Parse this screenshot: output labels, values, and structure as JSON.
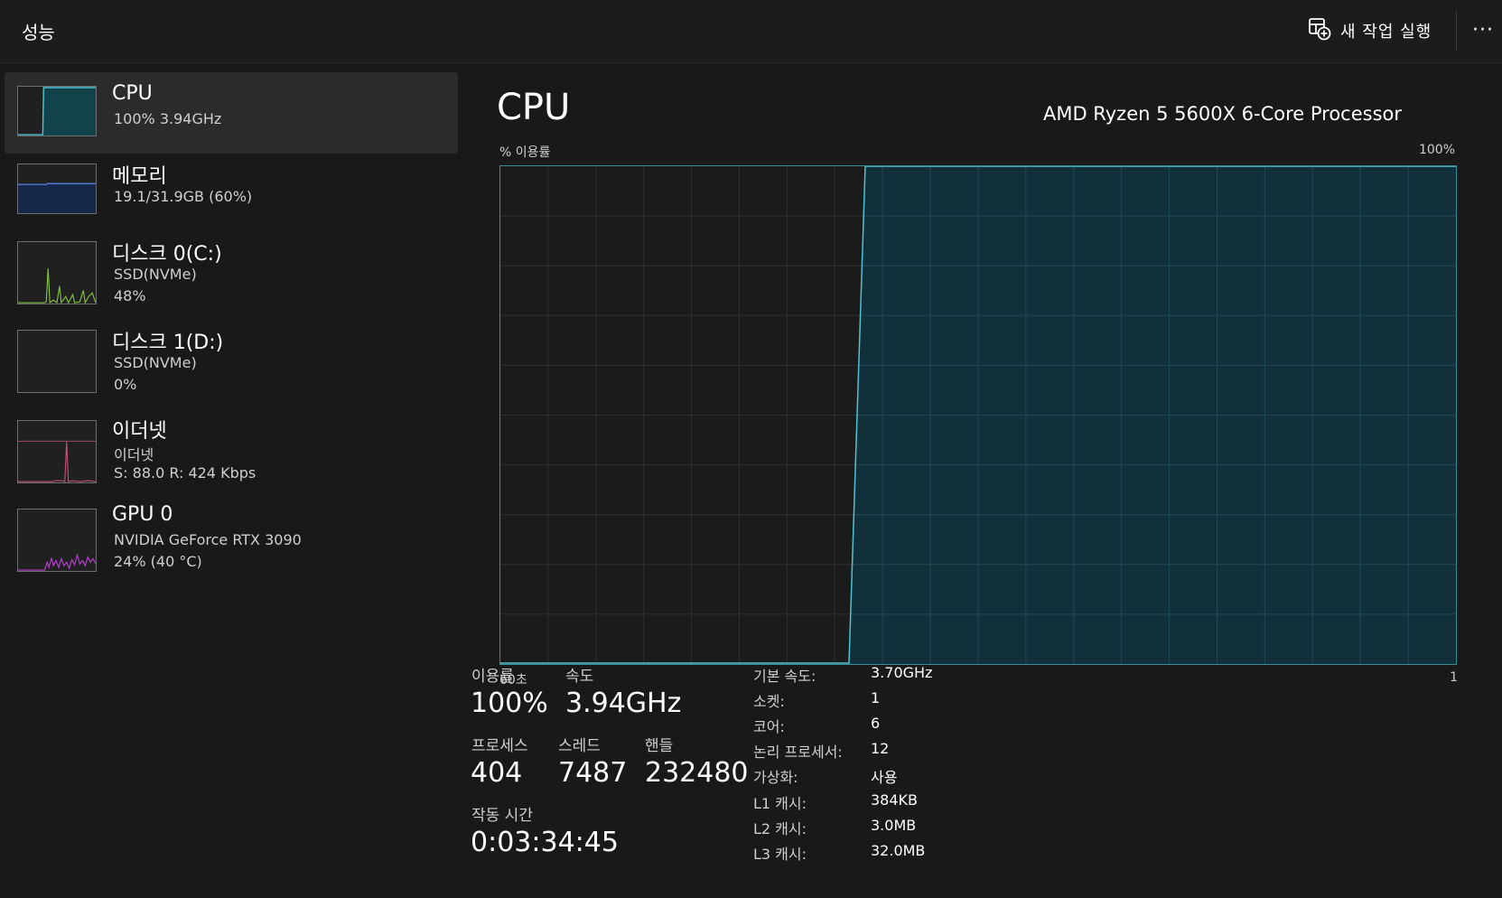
{
  "header": {
    "title": "성능",
    "new_task_label": "새 작업 실행",
    "more_label": "···"
  },
  "sidebar": {
    "items": [
      {
        "title": "CPU",
        "sub1": "100%  3.94GHz",
        "sub2": "",
        "color": "#4fc1d2",
        "active": true
      },
      {
        "title": "메모리",
        "sub1": "19.1/31.9GB (60%)",
        "sub2": "",
        "color": "#4f7bd2"
      },
      {
        "title": "디스크 0(C:)",
        "sub1": "SSD(NVMe)",
        "sub2": "48%",
        "color": "#7fbf3f"
      },
      {
        "title": "디스크 1(D:)",
        "sub1": "SSD(NVMe)",
        "sub2": "0%",
        "color": "#7fbf3f"
      },
      {
        "title": "이더넷",
        "sub1": "이더넷",
        "sub2": "S: 88.0  R: 424 Kbps",
        "color": "#c0527a"
      },
      {
        "title": "GPU 0",
        "sub1": "NVIDIA GeForce RTX 3090",
        "sub2": "24% (40 °C)",
        "color": "#b63fcf"
      }
    ]
  },
  "main": {
    "title": "CPU",
    "model": "AMD Ryzen 5 5600X 6-Core Processor",
    "graph_label_left": "% 이용률",
    "graph_label_right": "100%",
    "axis_left": "60초",
    "axis_right": "1",
    "stats": {
      "utilization_label": "이용률",
      "utilization_value": "100%",
      "speed_label": "속도",
      "speed_value": "3.94GHz",
      "process_label": "프로세스",
      "process_value": "404",
      "thread_label": "스레드",
      "thread_value": "7487",
      "handle_label": "핸들",
      "handle_value": "232480",
      "uptime_label": "작동 시간",
      "uptime_value": "0:03:34:45"
    },
    "info": [
      {
        "key": "기본 속도:",
        "value": "3.70GHz"
      },
      {
        "key": "소켓:",
        "value": "1"
      },
      {
        "key": "코어:",
        "value": "6"
      },
      {
        "key": "논리 프로세서:",
        "value": "12"
      },
      {
        "key": "가상화:",
        "value": "사용"
      },
      {
        "key": "L1 캐시:",
        "value": "384KB"
      },
      {
        "key": "L2 캐시:",
        "value": "3.0MB"
      },
      {
        "key": "L3 캐시:",
        "value": "32.0MB"
      }
    ]
  },
  "colors": {
    "cpu_line": "#4fc1d2",
    "cpu_fill": "#12303a",
    "grid": "#2f2f2f"
  }
}
